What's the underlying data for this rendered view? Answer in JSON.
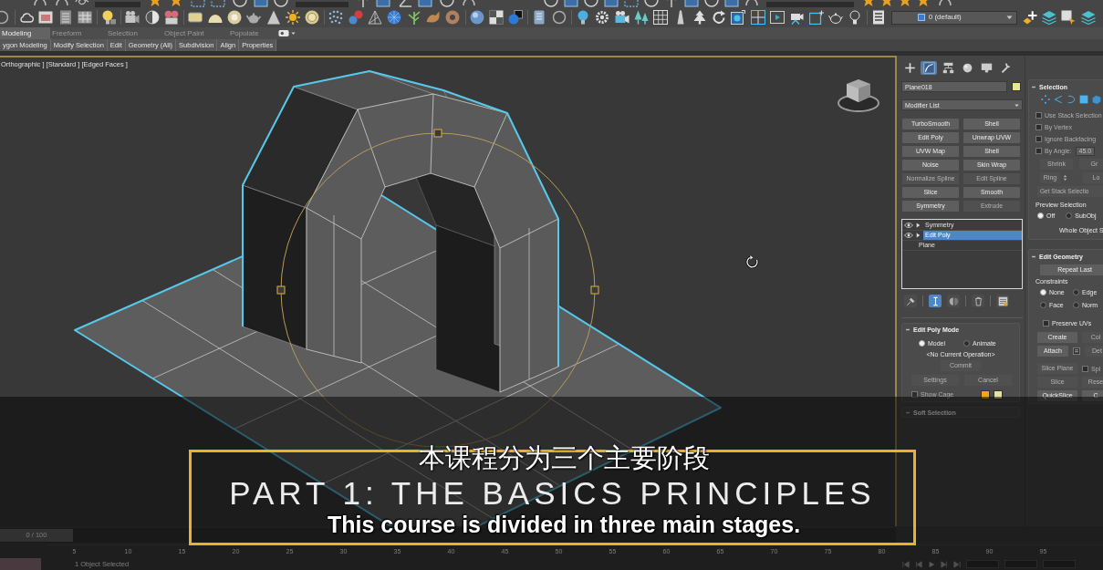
{
  "toolbar": {
    "layer": "0 (default)"
  },
  "ribbon": {
    "tabs": [
      {
        "label": "Modeling",
        "selected": true
      },
      {
        "label": "Freeform",
        "selected": false
      },
      {
        "label": "Selection",
        "selected": false
      },
      {
        "label": "Object Paint",
        "selected": false
      },
      {
        "label": "Populate",
        "selected": false
      }
    ],
    "panels": [
      "ygon Modeling",
      "Modify Selection",
      "Edit",
      "Geometry (All)",
      "Subdivision",
      "Align",
      "Properties"
    ]
  },
  "viewport": {
    "label": "Orthographic ] [Standard ] [Edged Faces ]"
  },
  "command_panel": {
    "tabs": [
      {
        "selected": false
      },
      {
        "selected": true
      },
      {
        "selected": false
      },
      {
        "selected": false
      },
      {
        "selected": false
      },
      {
        "selected": false
      }
    ],
    "object_name": "Plane018",
    "modifier_list": "Modifier List",
    "modifier_buttons": [
      {
        "label": "TurboSmooth",
        "disabled": false
      },
      {
        "label": "Shell",
        "disabled": false
      },
      {
        "label": "Edit Poly",
        "disabled": false
      },
      {
        "label": "Unwrap UVW",
        "disabled": false
      },
      {
        "label": "UVW Map",
        "disabled": false
      },
      {
        "label": "Shell",
        "disabled": false
      },
      {
        "label": "Noise",
        "disabled": false
      },
      {
        "label": "Skin Wrap",
        "disabled": false
      },
      {
        "label": "Normalize Spline",
        "disabled": true
      },
      {
        "label": "Edit Spline",
        "disabled": true
      },
      {
        "label": "Slice",
        "disabled": false
      },
      {
        "label": "Smooth",
        "disabled": false
      },
      {
        "label": "Symmetry",
        "disabled": false
      },
      {
        "label": "Extrude",
        "disabled": true
      }
    ],
    "modifier_stack": [
      {
        "kind": "modifier",
        "label": "Symmetry",
        "selected": false
      },
      {
        "kind": "modifier",
        "label": "Edit Poly",
        "selected": true
      },
      {
        "kind": "object",
        "label": "Plane",
        "selected": false
      }
    ],
    "stack_tools": [
      {
        "on": false
      },
      {
        "on": true
      },
      {
        "on": false
      },
      {
        "on": false
      },
      {
        "on": false
      }
    ],
    "edit_poly_mode": {
      "title": "Edit Poly Mode",
      "modes": [
        {
          "label": "Model",
          "selected": true
        },
        {
          "label": "Animate",
          "selected": false
        }
      ],
      "operation": "<No Current Operation>",
      "commit": {
        "label": "Commit",
        "disabled": true
      },
      "buttons": [
        {
          "label": "Settings",
          "disabled": true
        },
        {
          "label": "Cancel",
          "disabled": true
        }
      ],
      "show_cage": {
        "label": "Show Cage",
        "checked": false,
        "disabled": true
      }
    },
    "soft_selection": {
      "title": "Soft Selection"
    },
    "selection": {
      "title": "Selection",
      "options": [
        {
          "label": "Use Stack Selection",
          "checked": false,
          "disabled": true
        },
        {
          "label": "By Vertex",
          "checked": false,
          "disabled": true
        },
        {
          "label": "Ignore Backfacing",
          "checked": false,
          "disabled": true
        },
        {
          "label": "By Angle:",
          "checked": false,
          "disabled": true
        }
      ],
      "angle": "45.0",
      "buttons": [
        {
          "label": "Shrink",
          "disabled": true
        },
        {
          "label": "Gr",
          "disabled": true
        },
        {
          "label": "Ring",
          "disabled": true
        },
        {
          "label": "Lo",
          "disabled": true
        },
        {
          "label": "Get Stack Selectio",
          "disabled": true
        }
      ],
      "preview_title": "Preview Selection",
      "preview_modes": [
        {
          "label": "Off",
          "selected": true
        },
        {
          "label": "SubObj",
          "selected": false
        }
      ],
      "status": "Whole Object S"
    },
    "edit_geometry": {
      "title": "Edit Geometry",
      "repeat_last": "Repeat Last",
      "constraints_title": "Constraints",
      "constraints": [
        {
          "label": "None",
          "selected": true
        },
        {
          "label": "Edge",
          "selected": false
        },
        {
          "label": "Face",
          "selected": false
        },
        {
          "label": "Norm",
          "selected": false
        }
      ],
      "preserve_uvs": {
        "label": "Preserve UVs",
        "checked": false
      },
      "items": [
        {
          "kind": "button",
          "label": "Create",
          "disabled": false
        },
        {
          "kind": "button",
          "label": "Col",
          "disabled": true
        },
        {
          "kind": "button_settings",
          "label": "Attach",
          "disabled": false
        },
        {
          "kind": "button",
          "label": "Det",
          "disabled": true
        },
        {
          "kind": "button",
          "label": "Slice Plane",
          "disabled": true
        },
        {
          "kind": "checkbox",
          "label": "Spl",
          "disabled": true,
          "checked": false
        },
        {
          "kind": "button",
          "label": "Slice",
          "disabled": true
        },
        {
          "kind": "button",
          "label": "Rese",
          "disabled": true
        },
        {
          "kind": "button",
          "label": "QuickSlice",
          "disabled": false
        },
        {
          "kind": "button",
          "label": "C",
          "disabled": false
        }
      ]
    }
  },
  "timeline": {
    "frame": "0 / 100",
    "level": 0,
    "ticks": [
      "5",
      "10",
      "15",
      "20",
      "25",
      "30",
      "35",
      "40",
      "45",
      "50",
      "55",
      "60",
      "65",
      "70",
      "75",
      "80",
      "85",
      "90",
      "95"
    ]
  },
  "status_bar": {
    "selection": "1 Object Selected"
  },
  "video": {
    "title_card": "PART 1: THE BASICS PRINCIPLES",
    "subtitles": [
      "本课程分为三个主要阶段",
      "This course is divided in three main stages."
    ]
  }
}
